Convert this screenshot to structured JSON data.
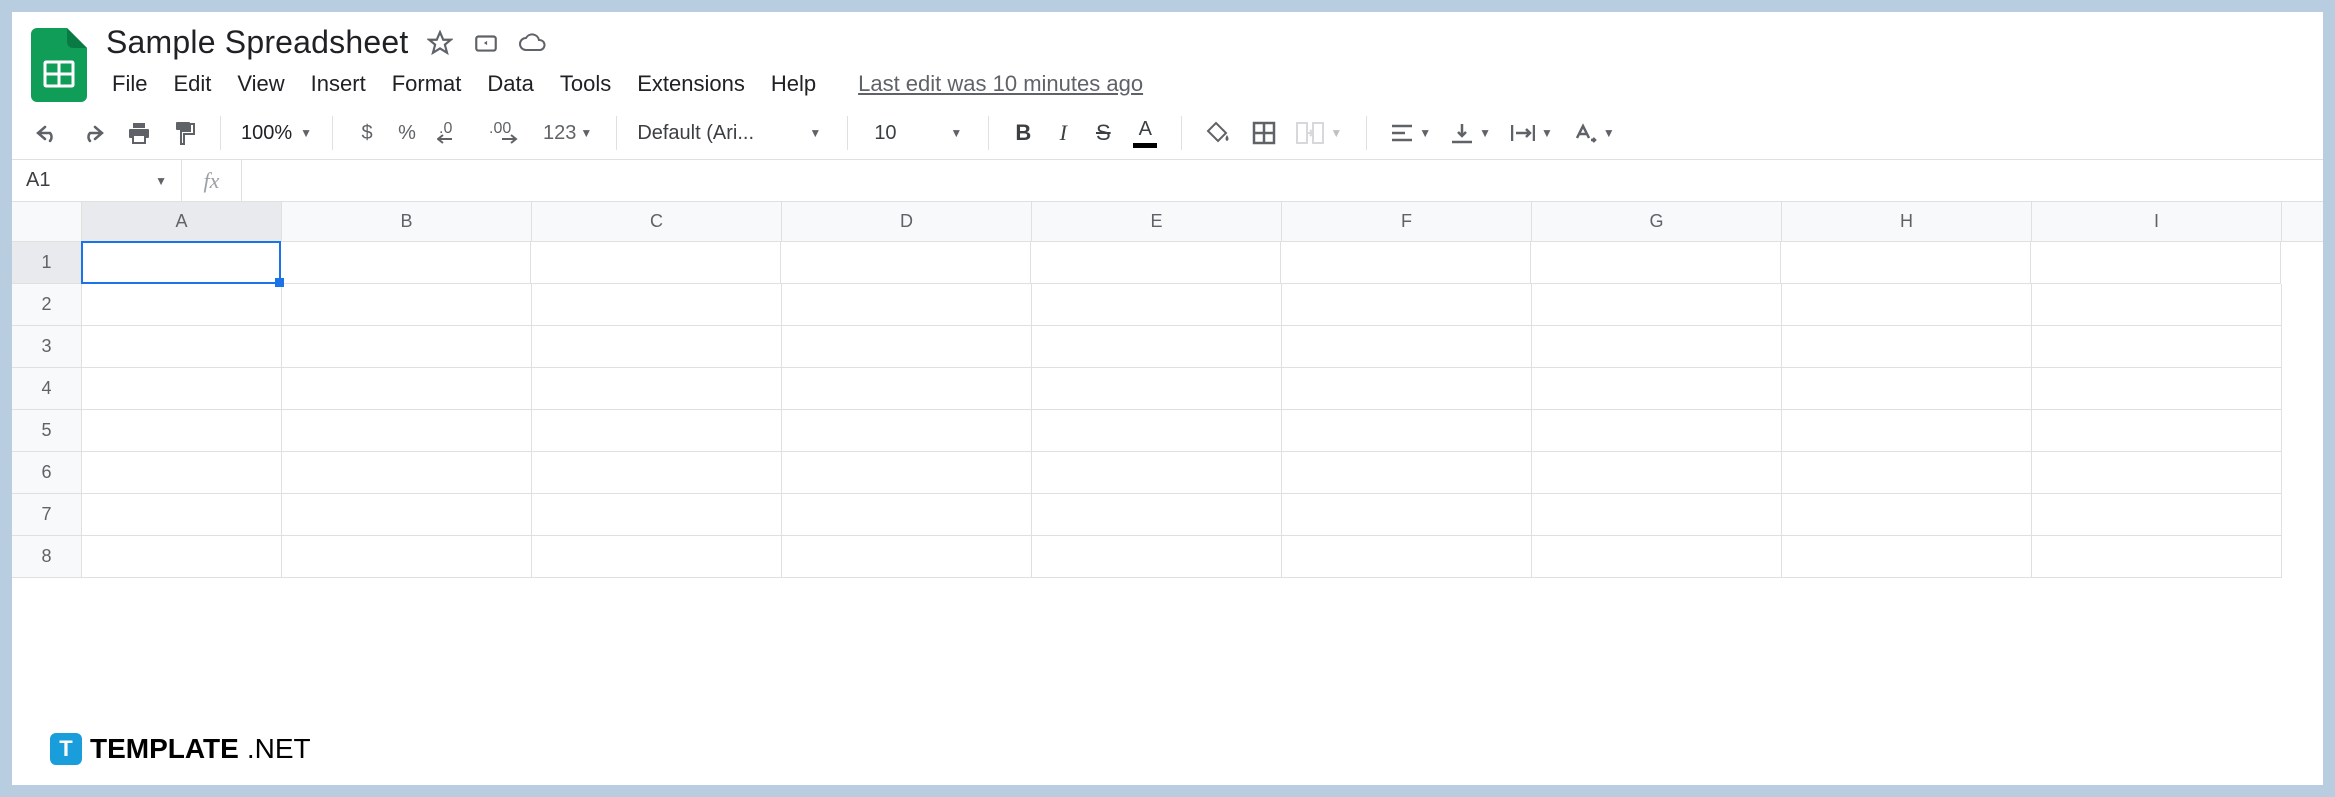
{
  "header": {
    "title": "Sample Spreadsheet",
    "menu": [
      "File",
      "Edit",
      "View",
      "Insert",
      "Format",
      "Data",
      "Tools",
      "Extensions",
      "Help"
    ],
    "last_edit": "Last edit was 10 minutes ago"
  },
  "toolbar": {
    "zoom": "100%",
    "currency": "$",
    "percent": "%",
    "dec_dec": ".0",
    "inc_dec": ".00",
    "more_formats": "123",
    "font": "Default (Ari...",
    "font_size": "10",
    "bold": "B",
    "italic": "I",
    "strike": "S",
    "text_color": "A"
  },
  "formula_bar": {
    "name_box": "A1",
    "fx": "fx",
    "value": ""
  },
  "grid": {
    "columns": [
      "A",
      "B",
      "C",
      "D",
      "E",
      "F",
      "G",
      "H",
      "I"
    ],
    "rows": [
      "1",
      "2",
      "3",
      "4",
      "5",
      "6",
      "7",
      "8"
    ],
    "selected_cell": "A1"
  },
  "watermark": {
    "icon_letter": "T",
    "brand": "TEMPLATE",
    "suffix": ".NET"
  }
}
